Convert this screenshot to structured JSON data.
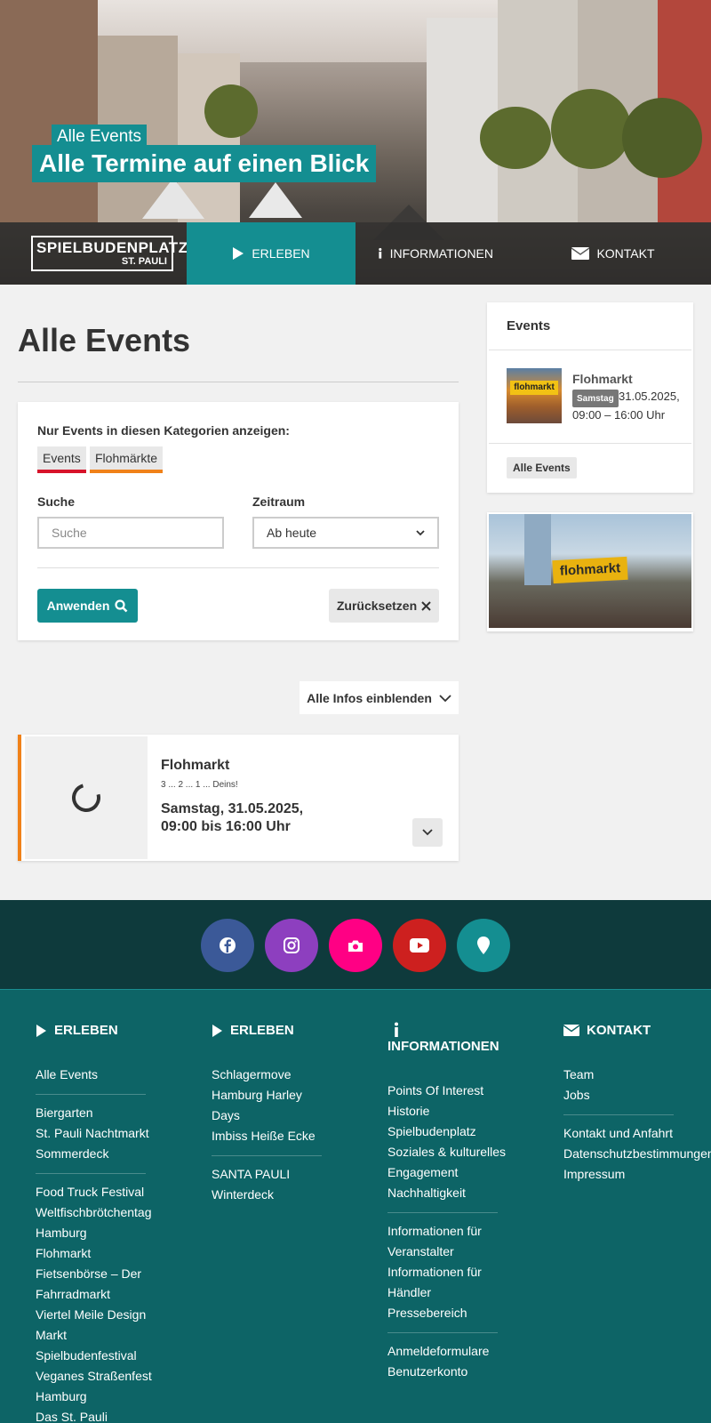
{
  "hero": {
    "subtitle": "Alle Events",
    "title": "Alle Termine auf einen Blick"
  },
  "logo": {
    "line1": "SPIELBUDENPLATZ",
    "line2": "ST. PAULI"
  },
  "nav": [
    {
      "label": "ERLEBEN",
      "icon": "play-icon"
    },
    {
      "label": "INFORMATIONEN",
      "icon": "info-icon"
    },
    {
      "label": "KONTAKT",
      "icon": "envelope-icon"
    }
  ],
  "main": {
    "title": "Alle Events",
    "filter": {
      "categories_label": "Nur Events in diesen Kategorien anzeigen:",
      "chips": [
        {
          "label": "Events",
          "color": "#d7132a"
        },
        {
          "label": "Flohmärkte",
          "color": "#f08119"
        }
      ],
      "search_label": "Suche",
      "search_placeholder": "Suche",
      "period_label": "Zeitraum",
      "period_value": "Ab heute",
      "apply_label": "Anwenden",
      "reset_label": "Zurücksetzen"
    },
    "show_all_label": "Alle Infos einblenden",
    "events": [
      {
        "title": "Flohmarkt",
        "subtitle": "3 ... 2 ... 1 ... Deins!",
        "date_line1": "Samstag, 31.05.2025,",
        "date_line2": "09:00 bis 16:00 Uhr"
      }
    ]
  },
  "sidebar": {
    "heading": "Events",
    "event": {
      "title": "Flohmarkt",
      "thumb_text": "flohmarkt",
      "badge": "Samstag",
      "date": "31.05.2025,",
      "time": "09:00 – 16:00 Uhr"
    },
    "all_events_label": "Alle Events",
    "promo_text": "flohmarkt"
  },
  "social": [
    {
      "name": "facebook",
      "color": "#3b5998"
    },
    {
      "name": "instagram",
      "color": "#8d3fbf"
    },
    {
      "name": "camera",
      "color": "#ff0084"
    },
    {
      "name": "youtube",
      "color": "#cd201f"
    },
    {
      "name": "location",
      "color": "#148e91"
    }
  ],
  "footer": {
    "col1": {
      "heading": "ERLEBEN",
      "groups": [
        [
          "Alle Events"
        ],
        [
          "Biergarten",
          "St. Pauli Nachtmarkt",
          "Sommerdeck"
        ],
        [
          "Food Truck Festival",
          "Weltfischbrötchentag",
          "Hamburg",
          "Flohmarkt",
          "Fietsenbörse – Der",
          "Fahrradmarkt",
          "Viertel Meile Design",
          "Markt",
          "Spielbudenfestival",
          "Veganes Straßenfest",
          "Hamburg",
          "Das St. Pauli"
        ]
      ]
    },
    "col2": {
      "heading": "ERLEBEN",
      "groups": [
        [
          "Schlagermove",
          "Hamburg Harley",
          "Days",
          "Imbiss Heiße Ecke"
        ],
        [
          "SANTA PAULI",
          "Winterdeck"
        ]
      ]
    },
    "col3": {
      "heading": "INFORMATIONEN",
      "groups": [
        [
          "Points Of Interest",
          "Historie",
          "Spielbudenplatz",
          "Soziales & kulturelles",
          "Engagement",
          "Nachhaltigkeit"
        ],
        [
          "Informationen für",
          "Veranstalter",
          "Informationen für",
          "Händler",
          "Pressebereich"
        ],
        [
          "Anmeldeformulare",
          "Benutzerkonto"
        ]
      ]
    },
    "col4": {
      "heading": "KONTAKT",
      "groups": [
        [
          "Team",
          "Jobs"
        ],
        [
          "Kontakt und Anfahrt",
          "Datenschutzbestimmungen",
          "Impressum"
        ]
      ]
    }
  }
}
